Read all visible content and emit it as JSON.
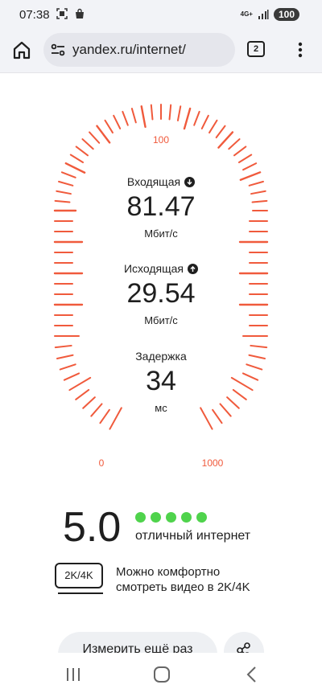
{
  "status_bar": {
    "time": "07:38",
    "network": "4G+",
    "battery": "100"
  },
  "browser": {
    "url": "yandex.ru/internet/",
    "tab_count": "2"
  },
  "gauge": {
    "label_top": "100",
    "label_left": "0",
    "label_right": "1000"
  },
  "download": {
    "label": "Входящая",
    "value": "81.47",
    "unit": "Мбит/с"
  },
  "upload": {
    "label": "Исходящая",
    "value": "29.54",
    "unit": "Мбит/с"
  },
  "latency": {
    "label": "Задержка",
    "value": "34",
    "unit": "мс"
  },
  "quality": {
    "score": "5.0",
    "stars_filled": 5,
    "stars_total": 5,
    "rating_text": "отличный интернет",
    "dot_color": "#4fd34c"
  },
  "video": {
    "badge": "2K/4K",
    "line1": "Можно комфортно",
    "line2": "смотреть видео в 2K/4K"
  },
  "actions": {
    "retest_label": "Измерить ещё раз"
  },
  "colors": {
    "gauge_tick": "#f05a3c"
  },
  "icons": {
    "home": "home-icon",
    "tune": "tune-icon",
    "menu": "more-vert-icon",
    "share": "share-icon",
    "download": "arrow-down-icon",
    "upload": "arrow-up-icon"
  }
}
